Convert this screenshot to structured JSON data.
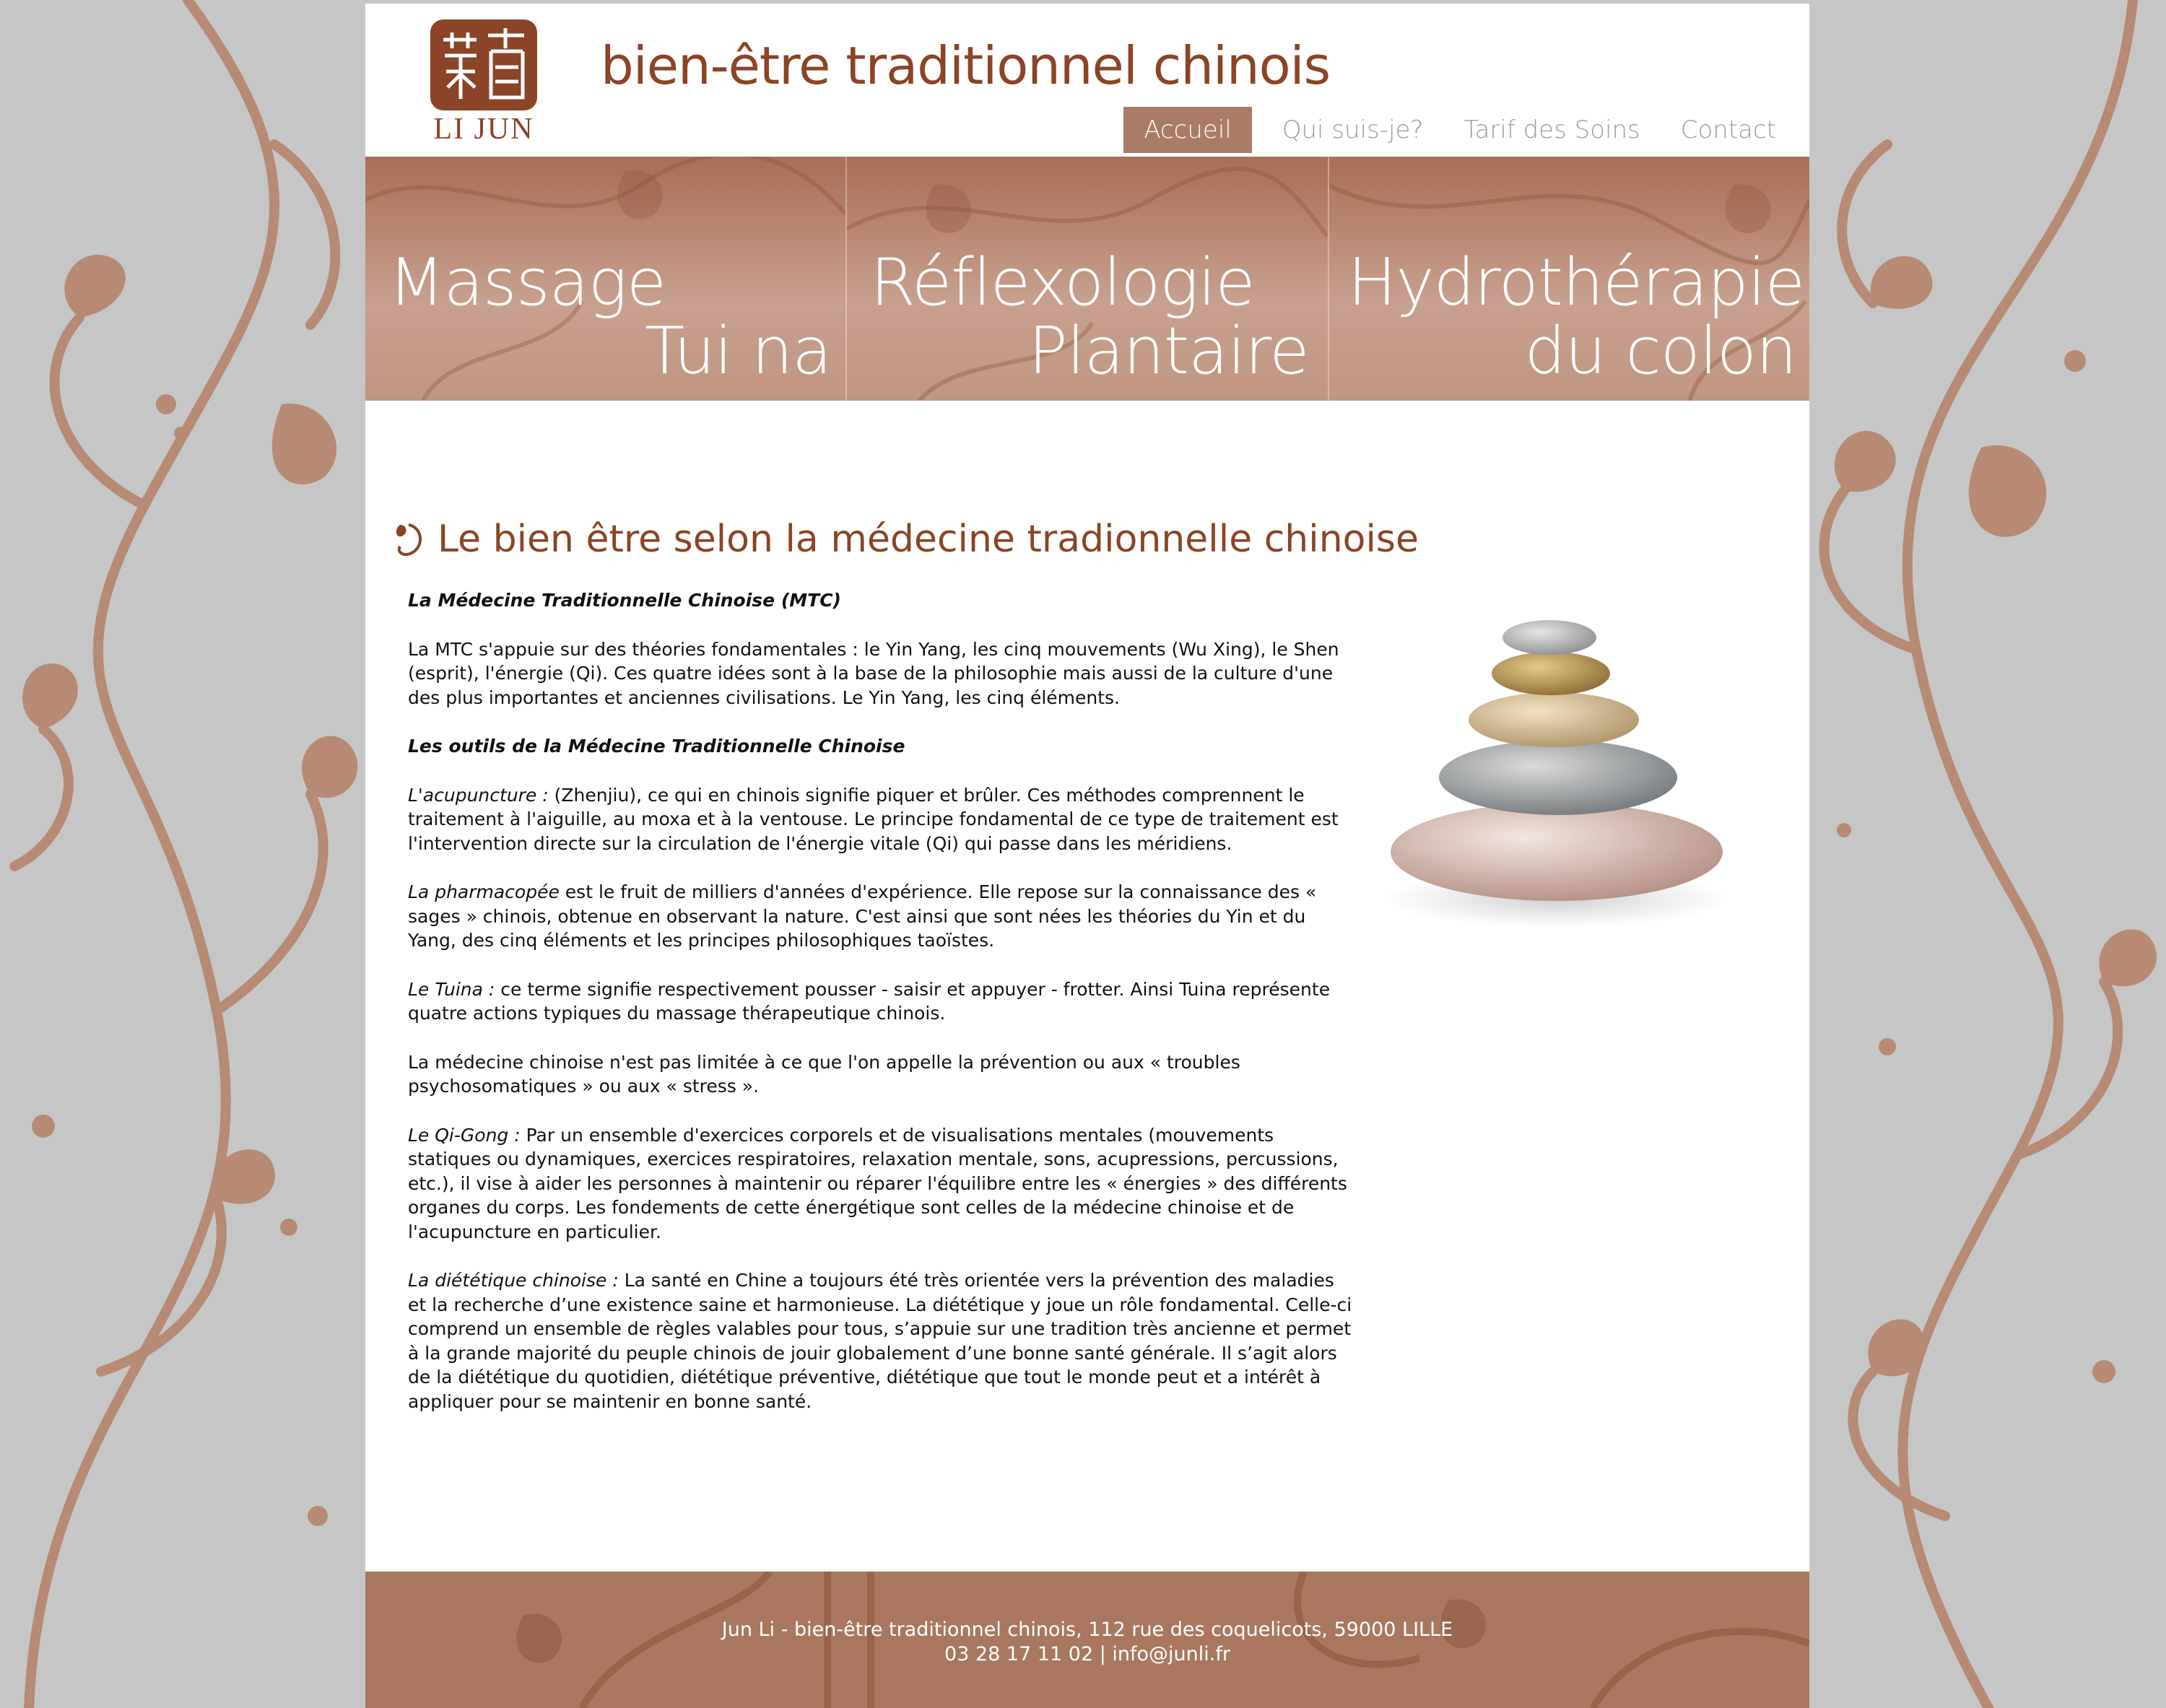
{
  "site": {
    "logo_text": "LI JUN",
    "title": "bien-être traditionnel chinois"
  },
  "nav": {
    "items": [
      {
        "label": "Accueil",
        "active": true
      },
      {
        "label": "Qui suis-je?"
      },
      {
        "label": "Tarif des Soins"
      },
      {
        "label": "Contact"
      }
    ]
  },
  "banner": {
    "panels": [
      {
        "line1": "Massage",
        "line2": "Tui na"
      },
      {
        "line1": "Réflexologie",
        "line2": "Plantaire"
      },
      {
        "line1": "Hydrothérapie",
        "line2": "du colon"
      }
    ]
  },
  "main": {
    "heading": "Le bien être selon la médecine tradionnelle chinoise",
    "p1_title": "La Médecine Traditionnelle Chinoise (MTC)",
    "p2": "La MTC s'appuie sur des théories fondamentales : le Yin Yang, les cinq mouvements (Wu Xing), le Shen (esprit), l'énergie (Qi). Ces quatre idées sont à la base de la philosophie mais aussi de la culture d'une des plus importantes et anciennes civilisations. Le Yin Yang, les cinq éléments.",
    "p3_title": "Les outils de la Médecine Traditionnelle Chinoise",
    "p4_lead": "L'acupuncture :",
    "p4": " (Zhenjiu), ce qui en chinois signifie piquer et brûler. Ces méthodes comprennent le traitement à l'aiguille, au moxa et à la ventouse. Le principe fondamental de ce type de traitement est l'intervention directe sur la circulation de l'énergie vitale (Qi) qui passe dans les méridiens.",
    "p5_lead": "La pharmacopée",
    "p5": " est le fruit de milliers d'années d'expérience. Elle repose sur la connaissance des « sages » chinois, obtenue en observant la nature. C'est ainsi que sont nées les théories du Yin et du Yang, des cinq éléments et les principes philosophiques taoïstes.",
    "p6_lead": "Le Tuina :",
    "p6": " ce terme signifie respectivement pousser - saisir et appuyer - frotter. Ainsi Tuina représente quatre actions typiques du massage thérapeutique chinois.",
    "p7": "La médecine chinoise n'est pas limitée à ce que l'on appelle la prévention ou aux « troubles psychosomatiques » ou aux « stress ».",
    "p8_lead": "Le Qi-Gong :",
    "p8": " Par un ensemble d'exercices corporels et de visualisations mentales (mouvements statiques ou dynamiques, exercices respiratoires, relaxation mentale, sons, acupressions, percussions, etc.), il vise à aider les personnes à maintenir ou réparer l'équilibre entre les « énergies » des différents organes du corps. Les fondements de cette énergétique sont celles de la médecine chinoise et de l'acupuncture en particulier.",
    "p9_lead": "La diététique chinoise :",
    "p9": " La santé en Chine a toujours été très orientée vers la prévention des maladies et la recherche d’une existence saine et harmonieuse. La diététique y joue un rôle fondamental. Celle-ci comprend un ensemble de règles valables pour tous, s’appuie sur une tradition très ancienne et permet à la grande majorité du peuple chinois de jouir globalement d’une bonne santé générale. Il s’agit alors de la diététique du quotidien, diététique préventive, diététique que tout le monde peut et a intérêt à appliquer pour se maintenir en bonne santé."
  },
  "footer": {
    "line1": "Jun Li - bien-être traditionnel chinois,  112 rue des coquelicots, 59000 LILLE",
    "line2": "03 28 17 11 02 | info@junli.fr"
  },
  "colors": {
    "brand": "#8b4425",
    "accent": "#ab7c65",
    "banner": "#b07a60",
    "background": "#c6c6c6"
  }
}
